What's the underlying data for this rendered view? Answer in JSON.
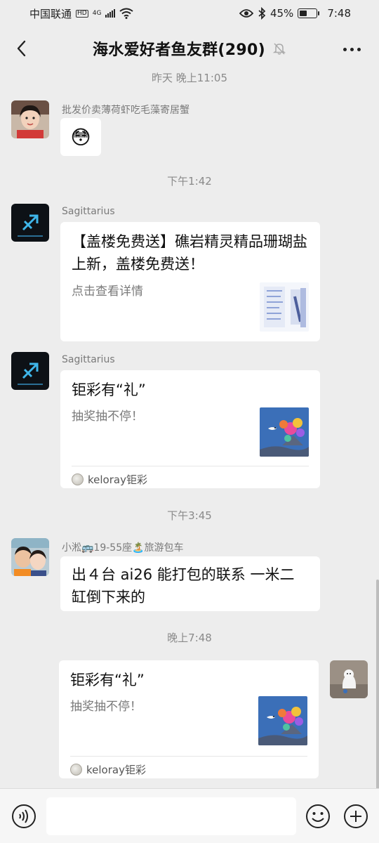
{
  "status_bar": {
    "carrier": "中国联通",
    "hd_badge": "HD",
    "network": "4G",
    "battery": "45%",
    "battery_level": 0.45,
    "time": "7:48"
  },
  "header": {
    "title": "海水爱好者鱼友群(290)",
    "icons": [
      "back-icon",
      "mute-icon",
      "more-icon"
    ]
  },
  "messages": [
    {
      "timestamp": "昨天 晚上11:05",
      "sender": "批发价卖薄荷虾吃毛藻寄居蟹",
      "type": "emoji",
      "emoji": "😳"
    },
    {
      "timestamp": "下午1:42",
      "sender": "Sagittarius",
      "type": "card",
      "title": "【盖楼免费送】礁岩精灵精品珊瑚盐上新，盖楼免费送！",
      "desc": "点击查看详情"
    },
    {
      "sender": "Sagittarius",
      "type": "card",
      "title": "钜彩有“礼”",
      "desc": "抽奖抽不停！",
      "source": "keloray钜彩"
    },
    {
      "timestamp": "下午3:45",
      "sender": "小淞🚌19-55座🏝️旅游包车",
      "type": "text",
      "text": "出４台 ai26 能打包的联系 一米二缸倒下来的"
    },
    {
      "timestamp": "晚上7:48",
      "type": "card",
      "self": true,
      "title": "钜彩有“礼”",
      "desc": "抽奖抽不停！",
      "source": "keloray钜彩"
    }
  ],
  "input_bar": {
    "icons": [
      "voice-icon",
      "emoji-icon",
      "plus-icon"
    ]
  },
  "colors": {
    "chat_background": "#ededed",
    "bubble": "#ffffff",
    "meta_text": "#8a8a8a"
  }
}
